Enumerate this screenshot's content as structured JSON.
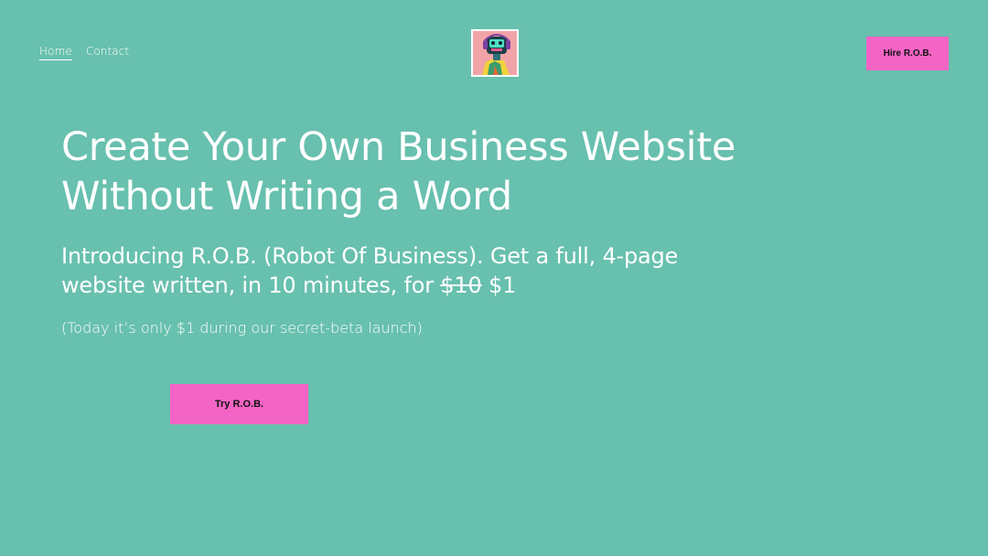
{
  "nav": {
    "home_label": "Home",
    "contact_label": "Contact"
  },
  "logo": {
    "alt": "R.O.B. robot avatar"
  },
  "header": {
    "hire_label": "Hire R.O.B."
  },
  "hero": {
    "headline": "Create Your Own Business Website Without Writing a Word",
    "subhead_prefix": "Introducing R.O.B. (Robot Of Business). Get a full, 4-page website written, in 10 minutes, for ",
    "old_price": "$10",
    "new_price": "$1",
    "note": "(Today it’s only $1 during our secret-beta launch)",
    "cta_label": "Try R.O.B."
  },
  "colors": {
    "background": "#68c0ae",
    "button": "#f464c5",
    "text": "#ffffff"
  }
}
